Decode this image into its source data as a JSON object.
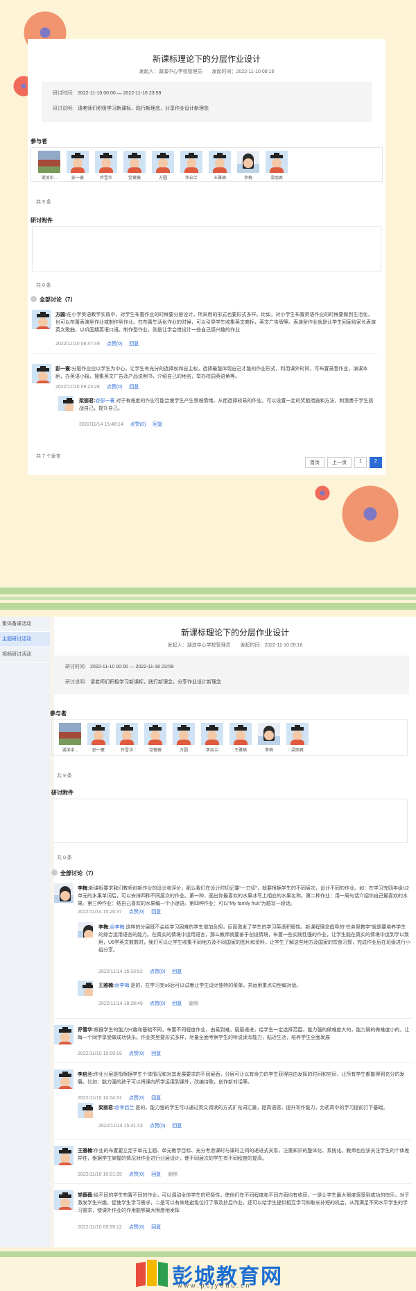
{
  "title": "新课标理论下的分层作业设计",
  "meta": {
    "initiator": "发起人：湖滨中心学校管理员",
    "time": "发起时间：2022-11-10 09:16"
  },
  "info": {
    "period_key": "研讨时间:",
    "period_val": "2022-11-10 00:00 — 2022-11-16 23:59",
    "desc_key": "研讨说明:",
    "desc_val": "请老师们积极学习新课标，践行新理念，分享作业设计新理念"
  },
  "participants_label": "参与者",
  "participants": [
    "湖滨中...",
    "彭一寰",
    "乔雪华",
    "党薇薇",
    "方圆",
    "李启兰",
    "王雅楠",
    "李梅",
    "梁丽君"
  ],
  "participants_count": "共 9 条",
  "attach_label": "研讨附件",
  "attach_count": "共 0 条",
  "all_discussion": "全部讨论（7）",
  "frame1": {
    "posts": [
      {
        "name": "方圆:",
        "text": "在小学英语教学实践中，对学生布置作业的时候要分层设计，所采用的形式也要形式多样。比如，对小学生布置英语作业的时候要做到生活化，也可以布置表演型作业或制作型作业。在布置生活化作业的时候，可以引导学生收集英文商标，英文广告牌等。表演型作业就是让学生回家给家长表演英文歌曲，以巩固期英语口语。制作型作业，则是让学会借设计一些自己感兴趣的作业",
        "time": "2022/11/10 08:47:49",
        "like": "点赞(0)",
        "reply": "回复"
      },
      {
        "name": "彭一寰:",
        "text": "分层作业应以学生为中心，让学生有充分的选择权和自主权，选择最能体现自己才能的作业形式，利用课外时间，可布置录音作业，演课本剧，办英语小报，搜集英文广告及产品说明书，介绍自己的地名，举办校园英语角等。",
        "time": "2022/11/10 09:23:28",
        "like": "点赞(0)",
        "reply": "回复"
      }
    ],
    "reply1": {
      "name": "梁丽君:",
      "at": "@彭一寰",
      "text": "对于有难度的作业可能会使学生产生畏难情绪，从而选择较易的作业。可以设置一定的奖励措施和方法，刺激勇于学生挑战自己，提升自己。",
      "time": "2022/11/14 15:48:14",
      "like": "点赞(0)",
      "reply": "回复"
    },
    "total": "共 7 个发言",
    "pager": [
      "首页",
      "上一页",
      "1",
      "2"
    ]
  },
  "sidebar": [
    "集体备课活动",
    "主题研讨活动",
    "视频研讨活动"
  ],
  "frame2": {
    "post_limei": {
      "name": "李梅:",
      "text": "新课标要求我们教师创新作业的设计和评价，那么我们在设计时切记要“一刀切”，就要根据学生的不同层次，设计不同的作业。如：在学习完四年级U2单元的水果单词后，可以安排四种不同层次的作业。第一种，画出你最喜欢的水果冰写上相应的水果名称。第二种作业：用一周句话介绍你自己最喜欢的水果。第三种作业：结自己喜欢的水果编一个小谜语。第四种作业：可以“My family fruit”为题写一段话。",
      "time": "2022/11/14 15:26:37",
      "like": "点赞(0)",
      "reply": "回复"
    },
    "reply_limei": {
      "name": "李梅:",
      "at": "@李梅",
      "text": "这样的分层既不会给学习困难的学生增加负担，反而激发了学生的学习英语积极性。新课程理念倡导的“任务型教学”就是要培养学生的综合运用语言的能力。在真实的情境中运用语言，那么教师就要善于创设情境，布置一些实践性强的作业，让学生能在真实的情境中运到学以致用，U6学英文数数时，我们可以让学生收集不同地方及不同国家的图片和资料，让学生了解这些地方及国家的饮食习惯，完成作业后在班级进行小组分享。",
      "time": "2022/11/14 15:33:52",
      "like": "点赞(0)",
      "reply": "回复"
    },
    "reply_wang": {
      "name": "王雅楠:",
      "at": "@李梅",
      "text": "是的，在学习完u6后可以试着让学生设计独特的菜单，并运用重点句型编对话。",
      "time": "2022/11/14 18:28:49",
      "like": "点赞(0)",
      "reply": "回复",
      "del": "删除"
    },
    "post_qiao": {
      "name": "乔雪华:",
      "text": "根据学生的能力兴趣和基础不同，布置不同程度作业，由易到难，层层递进，给学生一定选择范围，能力强的做难度大的，能力弱的做难度小的，让每一个同学享受做成功快乐。作业类型要形式多样，尽量全面考察学生的听说读写能力，贴近生活，培养学生全面发展",
      "time": "2022/11/10 10:09:19",
      "like": "点赞(0)",
      "reply": "回复"
    },
    "post_li": {
      "name": "李启兰:",
      "text": "作业分层是指根据学生个体情况和对其发展要求的不同层面，分层可让以有余力的学生获得自由发挥的时间和空间，让所有学生都能得到充分的发展。比如：能力强的孩子可以将课内所学运用到课外，改编诗歌，创作新对话等。",
      "time": "2022/11/10 10:04:31",
      "like": "点赞(0)",
      "reply": "回复"
    },
    "reply_liang": {
      "name": "梁丽君:",
      "at": "@李启兰",
      "text": "是的，能力强的学生可以通过英文阅读的方式扩充词汇量，提高语感，提升写作能力，为初高中的学习提前打下基础。",
      "time": "2022/11/14 15:41:13",
      "like": "点赞(0)",
      "reply": "回复"
    },
    "post_wang": {
      "name": "王雅楠:",
      "text": "作业的布置要立足于单元主题、单元教学目标、充分考虑课时与课时之间的递进式关系，注重知识的整体化、系统化。教师也应该关注学生的个体差异性，根据学生掌握的情况对作业进行分层设计，使不同层次的学生有不同程度的提高。",
      "time": "2022/11/10 10:01:39",
      "like": "点赞(0)",
      "reply": "回复",
      "del": "删除"
    },
    "post_dang": {
      "name": "党薇薇:",
      "text": "给不同的学生布置不同的作业，可以调动全体学生的积极性，使他们在不同程度和不同方面均有收获，一是让学生最大限度感受到成功的快乐，对于激发学生兴趣，促使学生学习需求，二是可以有效地避免位打了事及抄后作业，还可以给学生提供相互学习和取长补短的机会，从而满足不同水平学生的学习需求，使课外作业的作用能够最大限度地发挥",
      "time": "2022/11/10 09:59:12",
      "like": "点赞(0)",
      "reply": "回复"
    }
  },
  "logo": {
    "name": "彭城教育网",
    "url": "www.pcjyedu.cn"
  },
  "colors": {
    "accent": "#2b6bd6",
    "green_stripe": "#b9d89b",
    "bg": "#fdf3d6",
    "flower": "#f0956f"
  }
}
